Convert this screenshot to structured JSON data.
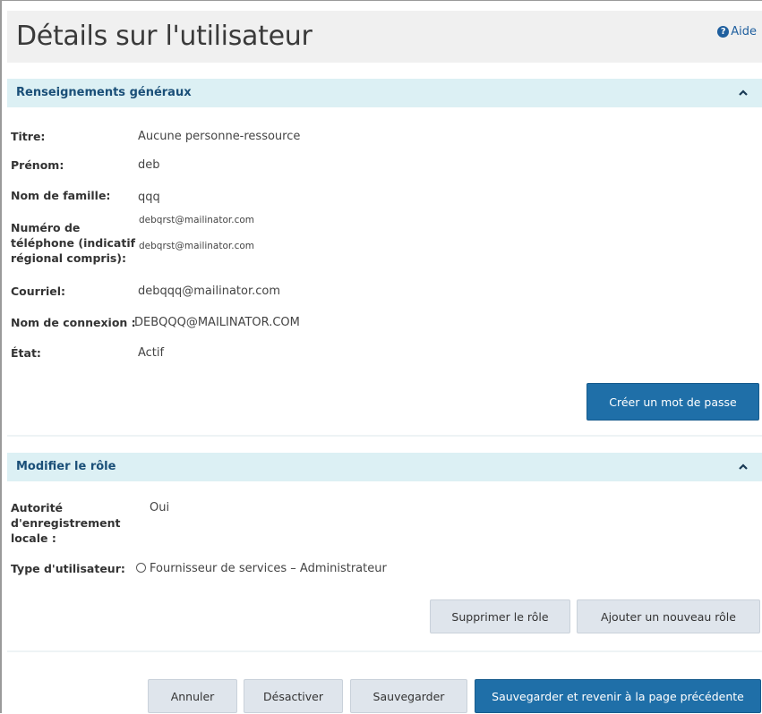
{
  "page": {
    "title": "Détails sur l'utilisateur",
    "help_label": "Aide"
  },
  "general_section": {
    "title": "Renseignements généraux",
    "fields": {
      "titre_label": "Titre:",
      "titre_value": "Aucune personne-ressource",
      "prenom_label": "Prénom:",
      "prenom_value": "deb",
      "nom_label": "Nom de famille:",
      "nom_value": "qqq",
      "phone_label_1": "Numéro de",
      "phone_label_2": "téléphone (indicatif",
      "phone_label_3": "régional compris):",
      "phone_value_1": "debqrst@mailinator.com",
      "phone_value_2": "debqrst@mailinator.com",
      "courriel_label": "Courriel:",
      "courriel_value": "debqqq@mailinator.com",
      "connexion_label": "Nom de connexion :",
      "connexion_value": "DEBQQQ@MAILINATOR.COM",
      "etat_label": "État:",
      "etat_value": "Actif"
    },
    "create_password_button": "Créer un mot de passe"
  },
  "role_section": {
    "title": "Modifier le rôle",
    "authority_label_1": "Autorité",
    "authority_label_2": "d'enregistrement",
    "authority_label_3": "locale :",
    "authority_value": "Oui",
    "user_type_label": "Type d'utilisateur:",
    "user_type_option": "Fournisseur de services – Administrateur",
    "delete_role_button": "Supprimer le rôle",
    "add_role_button": "Ajouter un nouveau rôle"
  },
  "footer": {
    "cancel_button": "Annuler",
    "deactivate_button": "Désactiver",
    "save_button": "Sauvegarder",
    "save_return_button": "Sauvegarder et revenir à la page précédente"
  }
}
